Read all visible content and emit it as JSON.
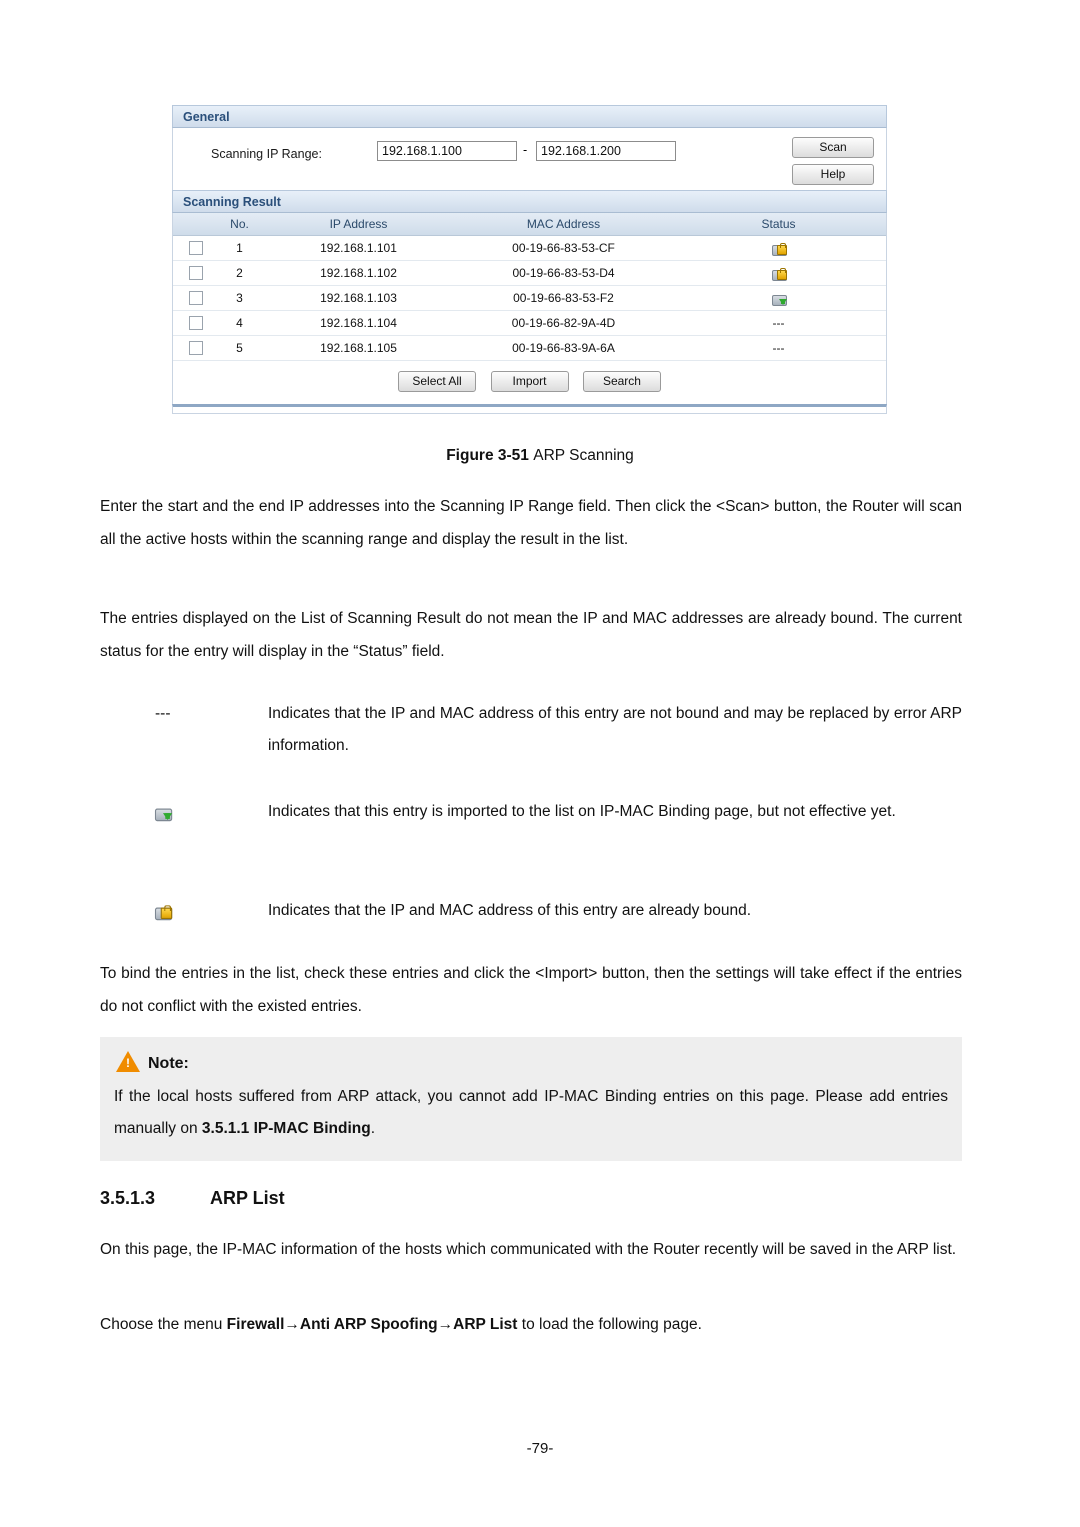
{
  "figure": {
    "general_title": "General",
    "scanning_label": "Scanning IP Range:",
    "ip_start": "192.168.1.100",
    "ip_end": "192.168.1.200",
    "dash": "-",
    "scan_button": "Scan",
    "help_button": "Help",
    "result_title": "Scanning Result",
    "columns": [
      "No.",
      "IP Address",
      "MAC Address",
      "Status"
    ],
    "rows": [
      {
        "no": "1",
        "ip": "192.168.1.101",
        "mac": "00-19-66-83-53-CF",
        "status": "bound"
      },
      {
        "no": "2",
        "ip": "192.168.1.102",
        "mac": "00-19-66-83-53-D4",
        "status": "bound"
      },
      {
        "no": "3",
        "ip": "192.168.1.103",
        "mac": "00-19-66-83-53-F2",
        "status": "imported"
      },
      {
        "no": "4",
        "ip": "192.168.1.104",
        "mac": "00-19-66-82-9A-4D",
        "status": "---"
      },
      {
        "no": "5",
        "ip": "192.168.1.105",
        "mac": "00-19-66-83-9A-6A",
        "status": "---"
      }
    ],
    "select_all_button": "Select All",
    "import_button": "Import",
    "search_button": "Search",
    "caption_bold": "Figure 3-51",
    "caption_rest": "ARP Scanning"
  },
  "body": {
    "p1": "Enter the start and the end IP addresses into the Scanning IP Range field. Then click the <Scan> button, the Router will scan all the active hosts within the scanning range and display the result in the list.",
    "p2": "The entries displayed on the List of Scanning Result do not mean the IP and MAC addresses are already bound. The current status for the entry will display in the “Status” field.",
    "legend": [
      {
        "mark": "---",
        "text": "Indicates that the IP and MAC address of this entry are not bound and may be replaced by error ARP information."
      },
      {
        "mark": "imported-icon",
        "text": "Indicates that this entry is imported to the list on IP-MAC Binding page, but not effective yet."
      },
      {
        "mark": "bound-icon",
        "text": "Indicates that the IP and MAC address of this entry are already bound."
      }
    ],
    "p3": "To bind the entries in the list, check these entries and click the <Import> button, then the settings will take effect if the entries do not conflict with the existed entries."
  },
  "note": {
    "title": "Note:",
    "text_part1": "If the local hosts suffered from ARP attack, you cannot add IP-MAC Binding entries on this page. Please add entries manually on ",
    "text_bold": "3.5.1.1 IP-MAC Binding",
    "text_part2": "."
  },
  "section": {
    "number": "3.5.1.3",
    "title": "ARP List",
    "p1": "On this page, the IP-MAC information of the hosts which communicated with the Router recently will be saved in the ARP list.",
    "p2_prefix": "Choose the menu ",
    "p2_bold": "Firewall→Anti ARP Spoofing→ARP List",
    "p2_suffix": " to load the following page."
  },
  "footer": {
    "page_number": "-79-"
  }
}
